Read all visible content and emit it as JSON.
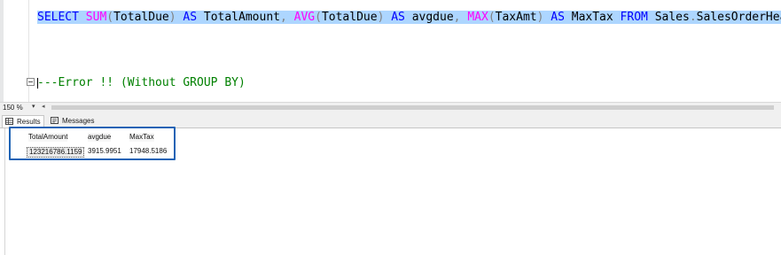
{
  "editor": {
    "line1": {
      "select": "SELECT",
      "sum": "SUM",
      "paren_open1": "(",
      "col1": "TotalDue",
      "paren_close1": ")",
      "as1": "AS",
      "alias1": "TotalAmount",
      "comma1": ",",
      "avg": "AVG",
      "paren_open2": "(",
      "col2": "TotalDue",
      "paren_close2": ")",
      "as2": "AS",
      "alias2": "avgdue",
      "comma2": ",",
      "max": "MAX",
      "paren_open3": "(",
      "col3": "TaxAmt",
      "paren_close3": ")",
      "as3": "AS",
      "alias3": "MaxTax",
      "from": "FROM",
      "table": "Sales",
      "dot": ".",
      "table2": "SalesOrderHeader"
    },
    "comment": "---Error !! (Without GROUP BY)"
  },
  "zoom": {
    "value": "150 %",
    "arrow": "▾",
    "scroll_left": "◂"
  },
  "tabs": [
    {
      "label": "Results",
      "icon": "grid-icon"
    },
    {
      "label": "Messages",
      "icon": "messages-icon"
    }
  ],
  "results": {
    "columns": [
      "TotalAmount",
      "avgdue",
      "MaxTax"
    ],
    "rows": [
      [
        "123216786.1159",
        "3915.9951",
        "17948.5186"
      ]
    ]
  },
  "colors": {
    "selection": "#add6ff",
    "keyword": "#0000ff",
    "function": "#ff00ff",
    "comment": "#008000",
    "highlight_box": "#1f63b5"
  }
}
